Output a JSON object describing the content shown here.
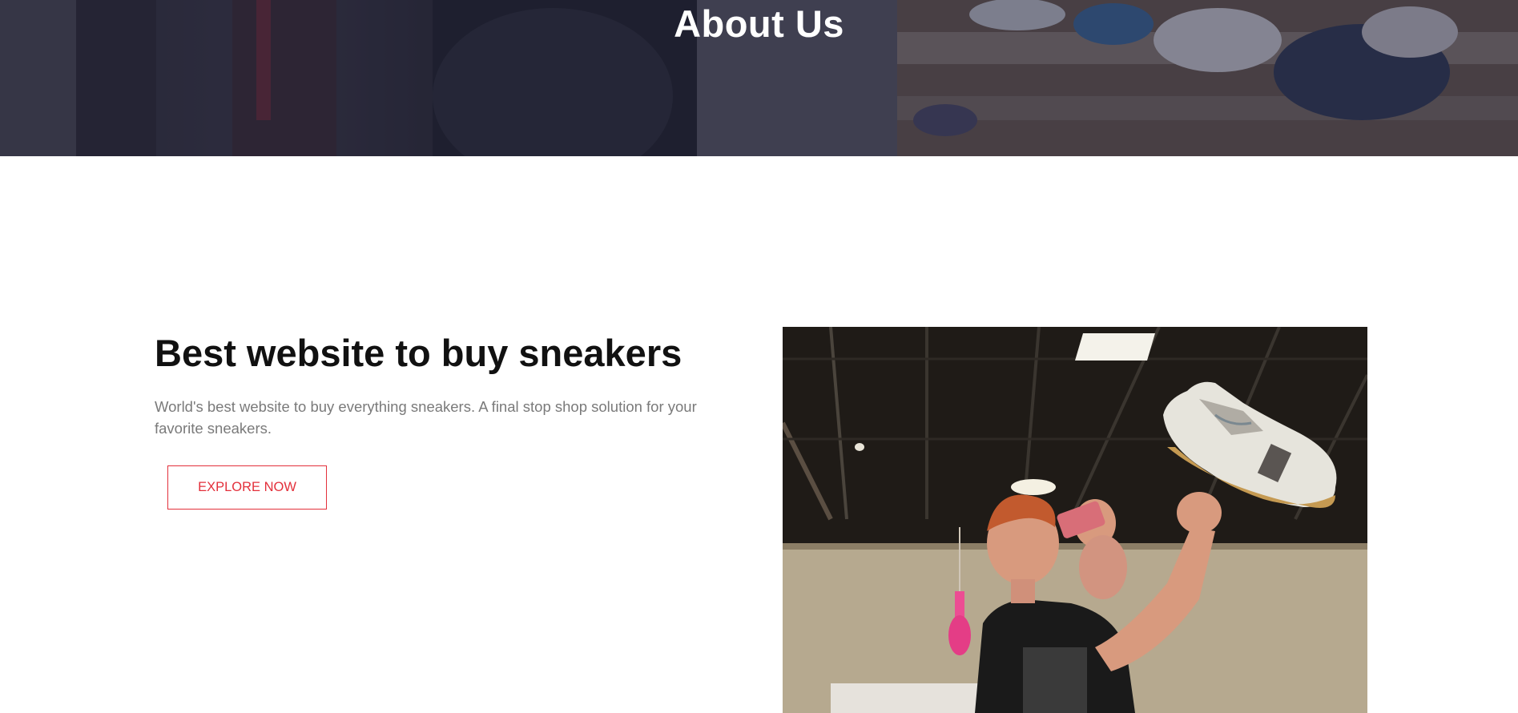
{
  "hero": {
    "title": "About Us"
  },
  "intro": {
    "heading": "Best website to buy sneakers",
    "description": "World's best website to buy everything sneakers. A final stop shop solution for your favorite sneakers.",
    "button_label": "EXPLORE NOW"
  },
  "colors": {
    "accent": "#e3303b",
    "heading": "#111111",
    "body_text": "#7a7a7a"
  }
}
